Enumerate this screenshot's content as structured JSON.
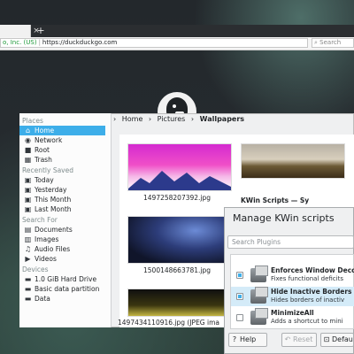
{
  "browser": {
    "tab_close": "×",
    "new_tab": "+",
    "url_secure": "o, Inc. (US)",
    "url_separator": "|",
    "url_text": "https://duckduckgo.com",
    "search_placeholder": "Search",
    "search_icon": "magnifier-icon"
  },
  "file_dialog": {
    "places": {
      "sections": [
        {
          "title": "Places",
          "items": [
            {
              "label": "Home",
              "icon": "home-icon",
              "active": true
            },
            {
              "label": "Network",
              "icon": "network-icon"
            },
            {
              "label": "Root",
              "icon": "folder-icon"
            },
            {
              "label": "Trash",
              "icon": "trash-icon"
            }
          ]
        },
        {
          "title": "Recently Saved",
          "items": [
            {
              "label": "Today",
              "icon": "calendar-icon"
            },
            {
              "label": "Yesterday",
              "icon": "calendar-icon"
            },
            {
              "label": "This Month",
              "icon": "calendar-icon"
            },
            {
              "label": "Last Month",
              "icon": "calendar-icon"
            }
          ]
        },
        {
          "title": "Search For",
          "items": [
            {
              "label": "Documents",
              "icon": "document-icon"
            },
            {
              "label": "Images",
              "icon": "image-icon"
            },
            {
              "label": "Audio Files",
              "icon": "music-icon"
            },
            {
              "label": "Videos",
              "icon": "video-icon"
            }
          ]
        },
        {
          "title": "Devices",
          "items": [
            {
              "label": "1.0 GiB Hard Drive",
              "icon": "drive-icon"
            },
            {
              "label": "Basic data partition",
              "icon": "drive-icon"
            },
            {
              "label": "Data",
              "icon": "drive-icon"
            }
          ]
        }
      ]
    },
    "breadcrumb": {
      "home": "Home",
      "pictures": "Pictures",
      "current": "Wallpapers"
    },
    "files": [
      {
        "name": "1497258207392.jpg"
      },
      {
        "name": "1500148663781.jpg"
      },
      {
        "name": "1497434110916.jpg (JPEG ima"
      }
    ],
    "partial_label": "KWin Scripts — Sy"
  },
  "kwin": {
    "title": "Manage KWin scripts",
    "search_placeholder": "Search Plugins",
    "plugins": [
      {
        "name": "Enforces Window Deco",
        "desc": "Fixes functional deficits",
        "checked": true,
        "selected": false
      },
      {
        "name": "Hide Inactive Borders",
        "desc": "Hides borders of inactiv",
        "checked": true,
        "selected": true
      },
      {
        "name": "MinimizeAll",
        "desc": "Adds a shortcut to mini",
        "checked": false,
        "selected": false
      }
    ],
    "buttons": {
      "help": "Help",
      "help_icon": "?",
      "reset": "Reset",
      "reset_icon": "↶",
      "defaults": "Defau",
      "defaults_icon": "⊡"
    }
  }
}
